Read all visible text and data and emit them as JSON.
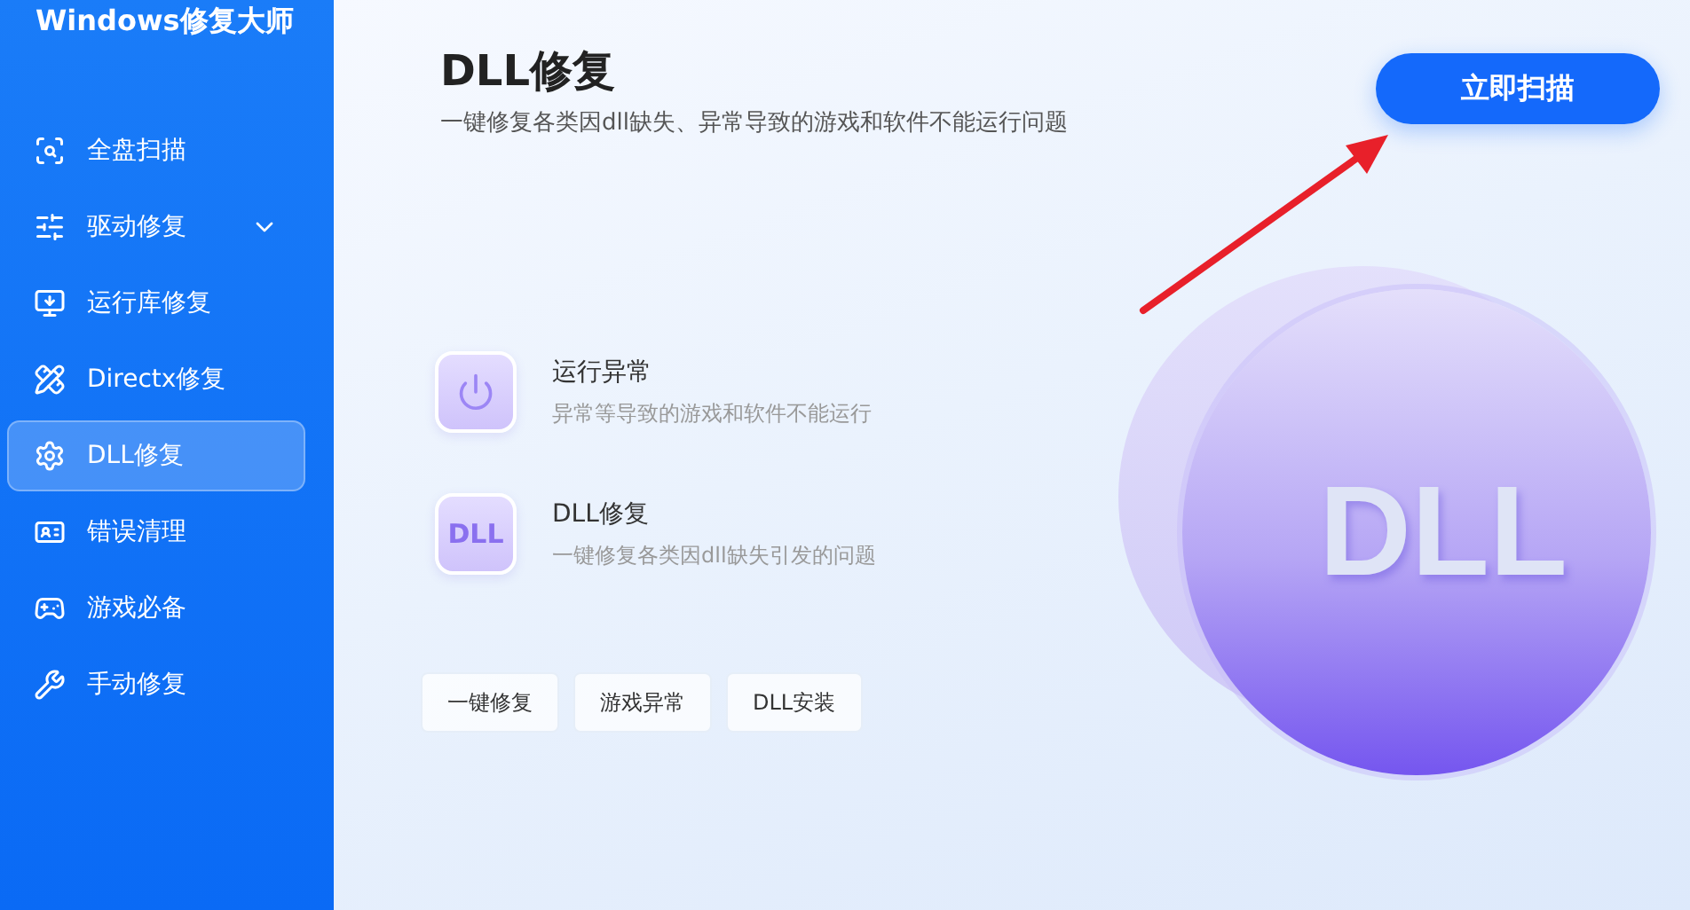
{
  "app": {
    "title": "Windows修复大师"
  },
  "sidebar": {
    "items": [
      {
        "label": "全盘扫描",
        "kind": "link",
        "selected": false
      },
      {
        "label": "驱动修复",
        "kind": "group",
        "selected": false
      },
      {
        "label": "运行库修复",
        "kind": "link",
        "selected": false
      },
      {
        "label": "Directx修复",
        "kind": "link",
        "selected": false
      },
      {
        "label": "DLL修复",
        "kind": "link",
        "selected": true
      },
      {
        "label": "错误清理",
        "kind": "link",
        "selected": false
      },
      {
        "label": "游戏必备",
        "kind": "link",
        "selected": false
      },
      {
        "label": "手动修复",
        "kind": "link",
        "selected": false
      }
    ]
  },
  "header": {
    "title": "DLL修复",
    "subtitle": "一键修复各类因dll缺失、异常导致的游戏和软件不能运行问题"
  },
  "scan_button": "立即扫描",
  "features": [
    {
      "kind": "power",
      "title": "运行异常",
      "description": "异常等导致的游戏和软件不能运行"
    },
    {
      "kind": "dll",
      "badge": "DLL",
      "title": "DLL修复",
      "description": "一键修复各类因dll缺失引发的问题"
    }
  ],
  "tags": [
    "一键修复",
    "游戏异常",
    "DLL安装"
  ],
  "illustration": {
    "text": "DLL"
  }
}
